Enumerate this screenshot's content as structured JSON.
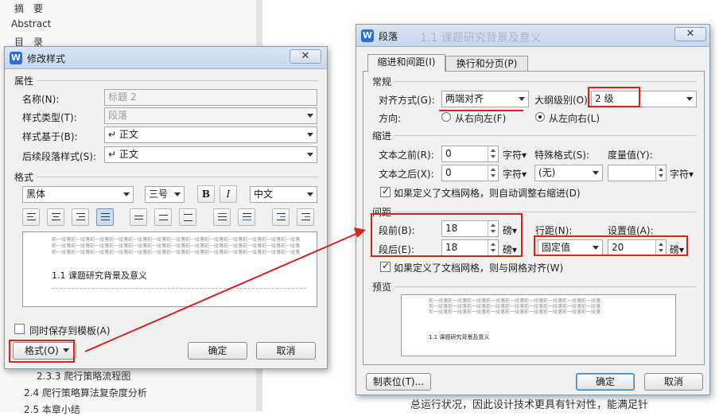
{
  "nav": {
    "items": [
      "摘　要",
      "Abstract",
      "目　录",
      "2.3.3  爬行策略流程图",
      "2.4  爬行策略算法复杂度分析",
      "2.5  本章小结"
    ]
  },
  "bg_text": "总运行状况，因此设计技术更具有针对性，能满足针",
  "modify_dialog": {
    "title": "修改样式",
    "close": "✕",
    "attrs_section": "属性",
    "name_label": "名称(N):",
    "name_value": "标题 2",
    "type_label": "样式类型(T):",
    "type_value": "段落",
    "based_label": "样式基于(B):",
    "based_value": "↵ 正文",
    "next_label": "后续段落样式(S):",
    "next_value": "↵ 正文",
    "format_section": "格式",
    "font": "黑体",
    "size": "三号",
    "bold": "B",
    "italic": "I",
    "lang": "中文",
    "preview_filler": "前一段落前一段落前一段落前一段落前一段落前一段落前一段落前一段落前一段落前一段落前一段落前一段落前一段落",
    "preview_heading": "1.1  课题研究背景及意义",
    "save_template": "同时保存到模板(A)",
    "format_button": "格式(O)",
    "ok": "确定",
    "cancel": "取消"
  },
  "para_dialog": {
    "title": "段落",
    "bg_title": "1.1  课题研究背景及意义",
    "close": "✕",
    "tabs": [
      "缩进和间距(I)",
      "换行和分页(P)"
    ],
    "general_section": "常规",
    "align_label": "对齐方式(G):",
    "align_value": "两端对齐",
    "outline_label": "大纲级别(O):",
    "outline_value": "2 级",
    "dir_label": "方向:",
    "rtl": "从右向左(F)",
    "ltr": "从左向右(L)",
    "indent_section": "缩进",
    "before_text_label": "文本之前(R):",
    "before_text_value": "0",
    "unit_char": "字符▾",
    "special_label": "特殊格式(S):",
    "special_value": "(无)",
    "measure_label": "度量值(Y):",
    "measure_unit": "字符▾",
    "after_text_label": "文本之后(X):",
    "after_text_value": "0",
    "grid_indent": "如果定义了文档网格，则自动调整右缩进(D)",
    "spacing_section": "间距",
    "before_label": "段前(B):",
    "before_value": "18",
    "pound": "磅▾",
    "after_label": "段后(E):",
    "after_value": "18",
    "line_label": "行距(N):",
    "line_value": "固定值",
    "set_label": "设置值(A):",
    "set_value": "20",
    "grid_align": "如果定义了文档网格，则与网格对齐(W)",
    "preview_section": "预览",
    "preview_filler": "前一段落前一段落前一段落前一段落前一段落前一段落前一段落前一段落前一段落",
    "preview_heading": "1.1 课题研究背景及意义",
    "tabs_button": "制表位(T)...",
    "ok": "确定",
    "cancel": "取消"
  },
  "colors": {
    "annotation": "#e02020",
    "accent": "#2b6cd9"
  }
}
